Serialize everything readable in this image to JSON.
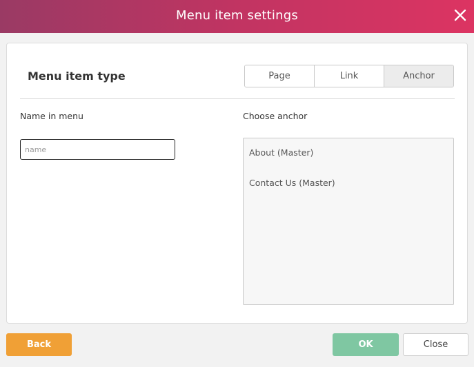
{
  "dialog": {
    "title": "Menu item settings",
    "close_icon": "close-icon",
    "accent_gradient": [
      "#9a3a64",
      "#dc3462"
    ]
  },
  "section": {
    "title": "Menu item type"
  },
  "type_tabs": [
    {
      "label": "Page",
      "active": false
    },
    {
      "label": "Link",
      "active": false
    },
    {
      "label": "Anchor",
      "active": true
    }
  ],
  "form": {
    "name_label": "Name in menu",
    "name_value": "",
    "name_placeholder": "name",
    "anchor_label": "Choose anchor",
    "anchors": [
      "About (Master)",
      "Contact Us (Master)"
    ]
  },
  "footer": {
    "back_label": "Back",
    "ok_label": "OK",
    "close_label": "Close",
    "colors": {
      "back": "#f0a036",
      "ok": "#7fc7a2"
    }
  }
}
